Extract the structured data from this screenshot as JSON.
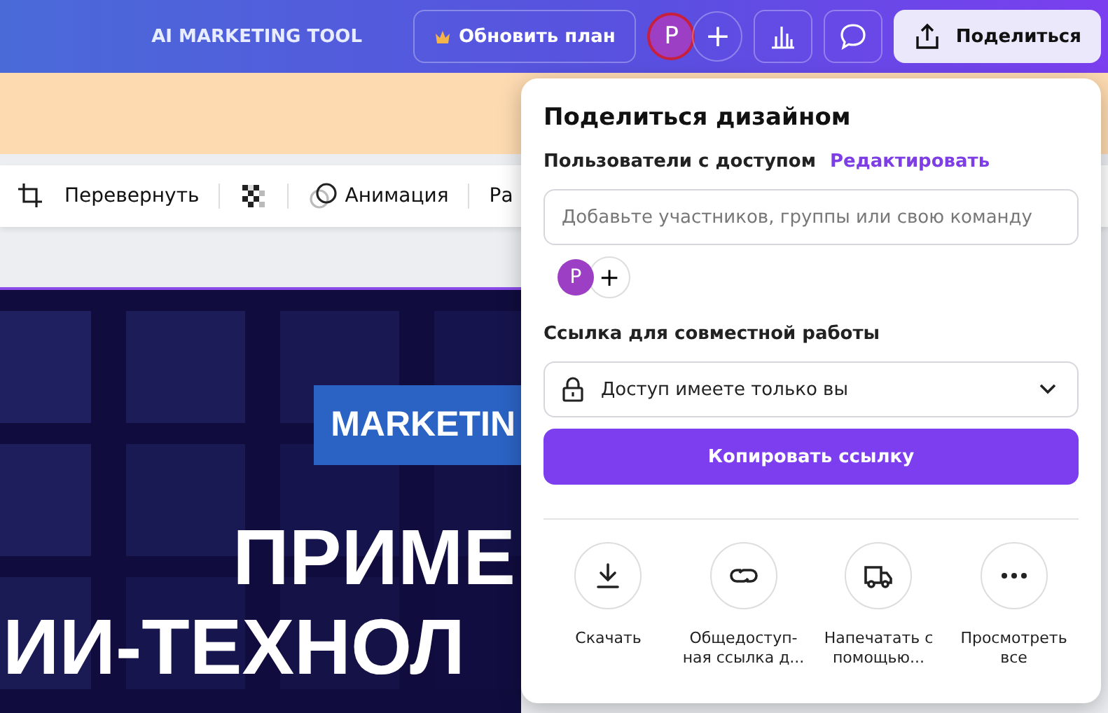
{
  "topbar": {
    "title": "AI MARKETING TOOL",
    "upgrade_button": "Обновить план",
    "avatar_initial": "P",
    "add_button": "+",
    "share_button": "Поделиться"
  },
  "toolbar": {
    "items": [
      {
        "kind": "crop"
      },
      {
        "kind": "text",
        "label": "Перевернуть"
      },
      {
        "kind": "divider"
      },
      {
        "kind": "transparency"
      },
      {
        "kind": "divider"
      },
      {
        "kind": "animate",
        "label": "Анимация"
      },
      {
        "kind": "divider"
      },
      {
        "kind": "text",
        "label": "Ра"
      }
    ]
  },
  "design": {
    "tag": "MARKETIN",
    "headline": [
      "ПРИМЕ",
      "ИИ-ТЕХНОЛ"
    ]
  },
  "share_panel": {
    "title": "Поделиться дизайном",
    "access_label": "Пользователи с доступом",
    "edit_link": "Редактировать",
    "invite_field": {
      "placeholder": "Добавьте участников, группы или свою команду"
    },
    "member_initial": "P",
    "add_member": "+",
    "link_label": "Ссылка для совместной работы",
    "access_select": {
      "value": "Доступ имеете только вы"
    },
    "copy_button": "Копировать ссылку",
    "actions": [
      {
        "kind": "download",
        "label": "Скачать"
      },
      {
        "kind": "link",
        "label": "Общедоступ-ная ссылка д..."
      },
      {
        "kind": "truck",
        "label": "Напечатать с помощью..."
      },
      {
        "kind": "more",
        "label": "Просмотреть все"
      }
    ]
  }
}
